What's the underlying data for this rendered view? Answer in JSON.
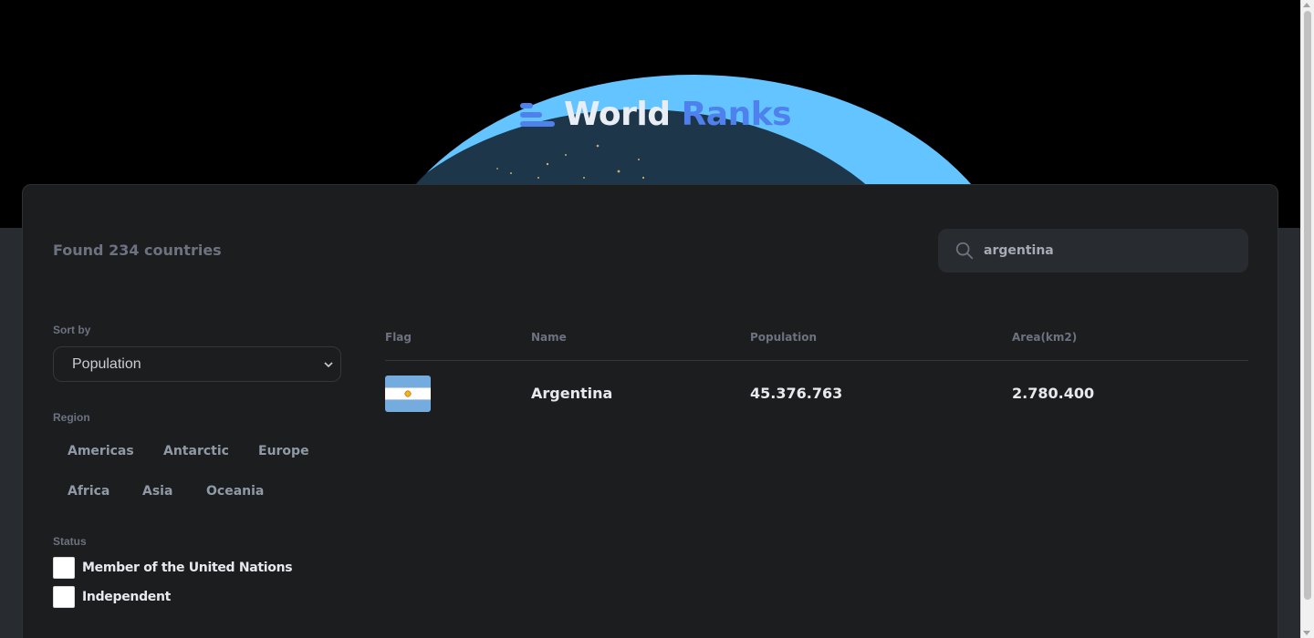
{
  "header": {
    "logo_word_1": "World",
    "logo_word_2": "Ranks",
    "accent_color": "#4E80EE"
  },
  "summary": {
    "found_text": "Found 234 countries"
  },
  "search": {
    "value": "argentina",
    "icon": "search-icon"
  },
  "filters": {
    "sort_label": "Sort by",
    "sort_selected": "Population",
    "region_label": "Region",
    "regions": [
      "Americas",
      "Antarctic",
      "Europe",
      "Africa",
      "Asia",
      "Oceania"
    ],
    "status_label": "Status",
    "status_options": [
      "Member of the United Nations",
      "Independent"
    ]
  },
  "table": {
    "headers": [
      "Flag",
      "Name",
      "Population",
      "Area(km2)"
    ],
    "rows": [
      {
        "flag": "argentina-flag",
        "name": "Argentina",
        "population": "45.376.763",
        "area": "2.780.400"
      }
    ]
  }
}
